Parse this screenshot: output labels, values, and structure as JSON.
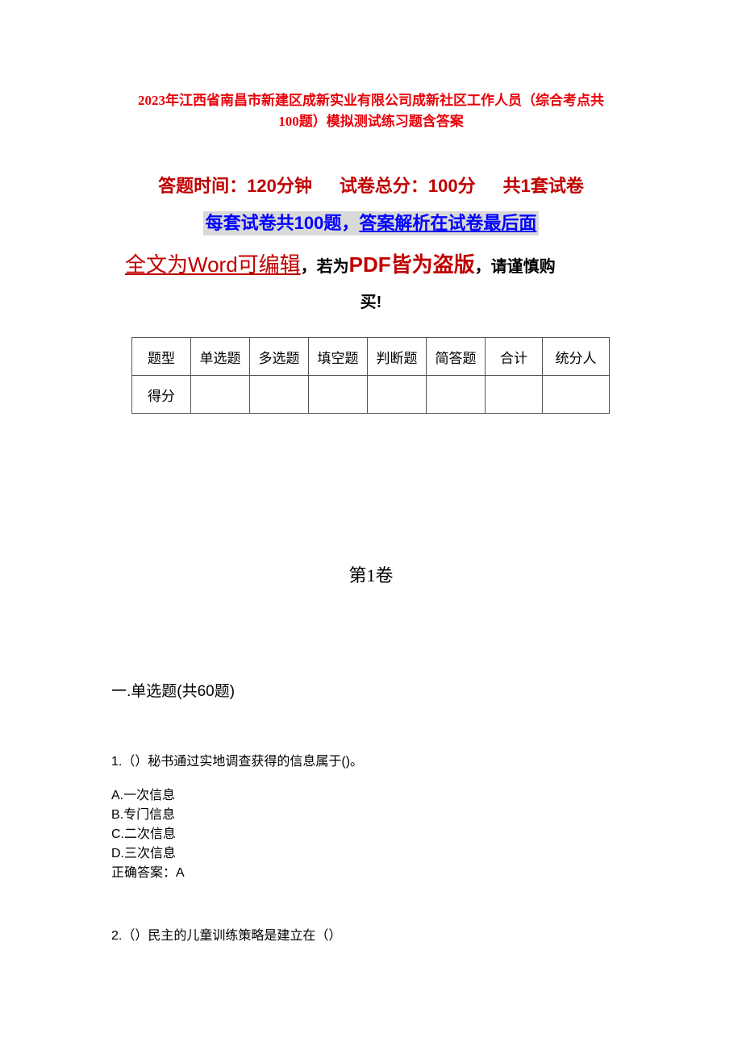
{
  "document": {
    "title_line1": "2023年江西省南昌市新建区成新实业有限公司成新社区工作人员（综合考点共",
    "title_line2": "100题）模拟测试练习题含答案",
    "meta": {
      "time": "答题时间：120分钟",
      "total": "试卷总分：100分",
      "sets": "共1套试卷"
    },
    "notice": {
      "part1": "每套试卷共100题，",
      "part2": "答案解析在试卷最后面"
    },
    "warning": {
      "underlined": "全文为Word可编辑",
      "comma1": "，若为",
      "pdf": "PDF皆为盗版",
      "rest": "，请谨慎购",
      "line2": "买!"
    },
    "score_table": {
      "headers": [
        "题型",
        "单选题",
        "多选题",
        "填空题",
        "判断题",
        "简答题",
        "合计",
        "统分人"
      ],
      "row_label": "得分",
      "row_values": [
        "",
        "",
        "",
        "",
        "",
        "",
        ""
      ]
    },
    "section_title": "第1卷",
    "part_title": "一.单选题(共60题)",
    "questions": [
      {
        "text": "1.（）秘书通过实地调查获得的信息属于()。",
        "options": [
          "A.一次信息",
          "B.专门信息",
          "C.二次信息",
          "D.三次信息"
        ],
        "answer": "正确答案：A"
      },
      {
        "text": "2.（）民主的儿童训练策略是建立在（）"
      }
    ]
  }
}
